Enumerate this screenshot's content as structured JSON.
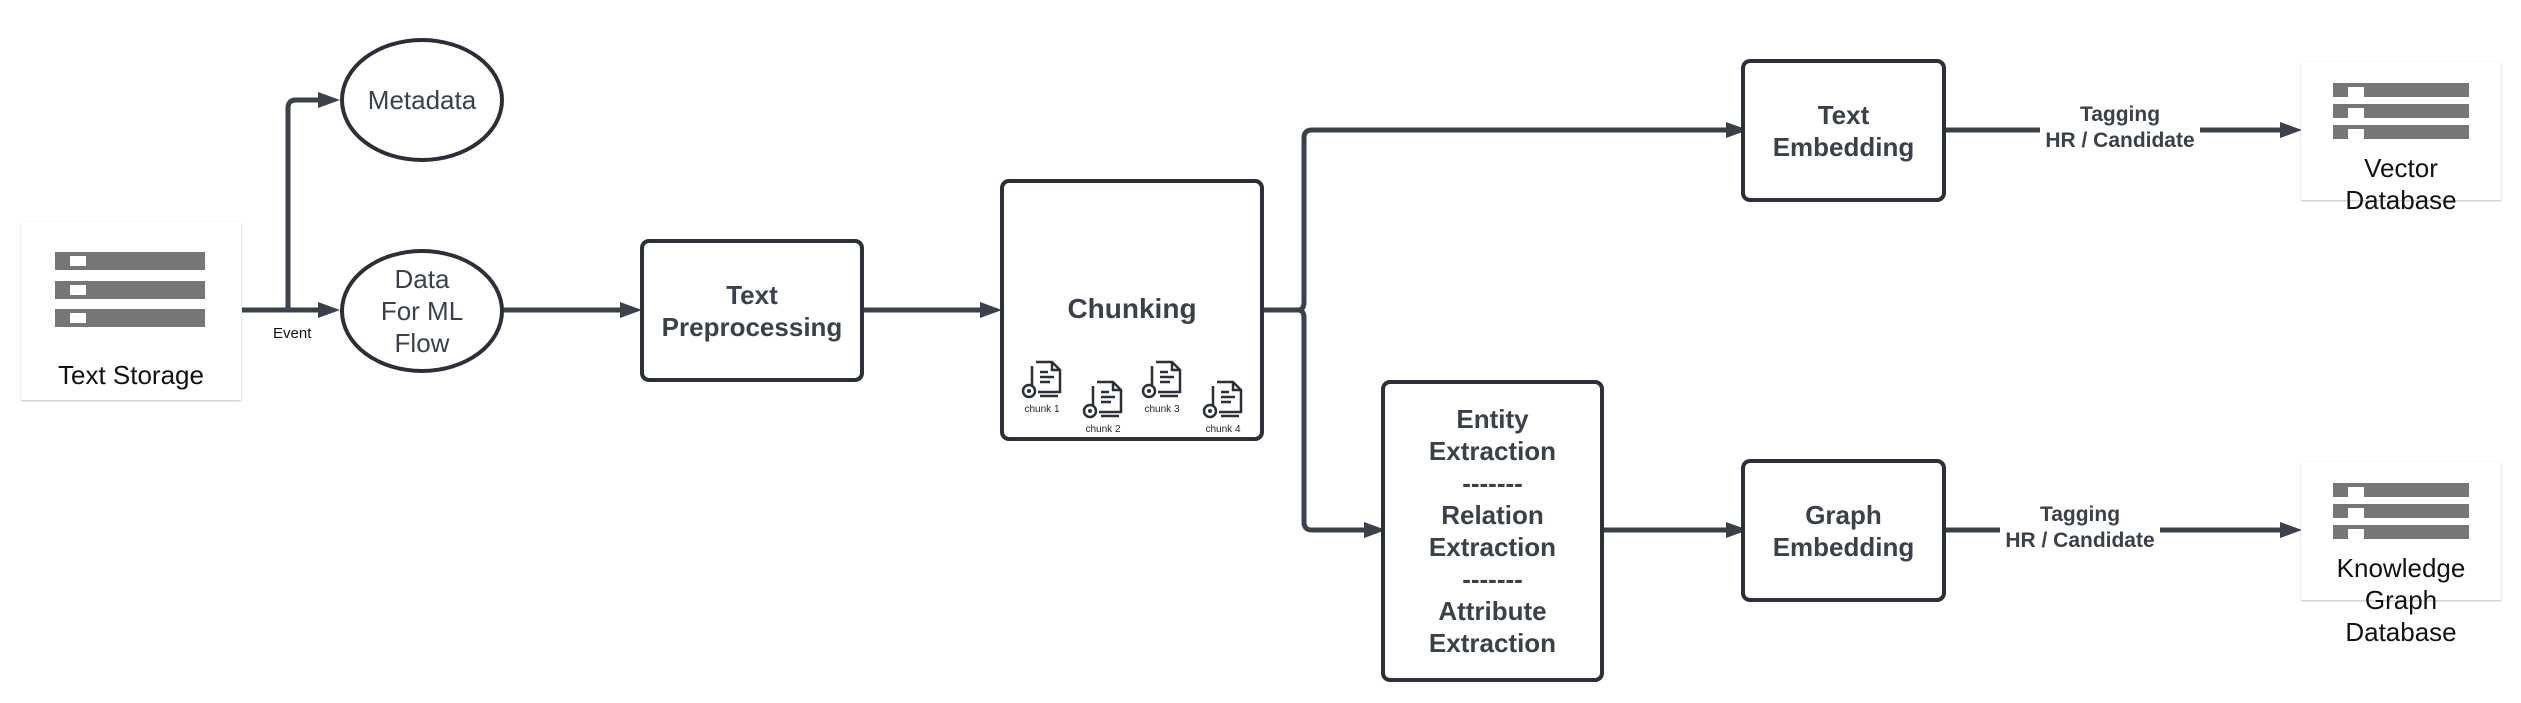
{
  "diagram": {
    "nodes": {
      "text_storage": {
        "label": "Text Storage",
        "icon": "database-icon"
      },
      "metadata": {
        "label": "Metadata"
      },
      "data_for_ml": {
        "lines": [
          "Data",
          "For ML",
          "Flow"
        ]
      },
      "text_preprocessing": {
        "lines": [
          "Text",
          "Preprocessing"
        ]
      },
      "chunking": {
        "label": "Chunking",
        "chunks": [
          {
            "label": "chunk 1",
            "icon": "document-gear-icon"
          },
          {
            "label": "chunk 2",
            "icon": "document-gear-icon"
          },
          {
            "label": "chunk 3",
            "icon": "document-gear-icon"
          },
          {
            "label": "chunk 4",
            "icon": "document-gear-icon"
          }
        ]
      },
      "extraction": {
        "lines": [
          "Entity",
          "Extraction",
          "-------",
          "Relation",
          "Extraction",
          "-------",
          "Attribute",
          "Extraction"
        ]
      },
      "text_embedding": {
        "lines": [
          "Text",
          "Embedding"
        ]
      },
      "graph_embedding": {
        "lines": [
          "Graph",
          "Embedding"
        ]
      },
      "vector_db": {
        "lines": [
          "Vector",
          "Database"
        ],
        "icon": "database-icon"
      },
      "kg_db": {
        "lines": [
          "Knowledge",
          "Graph",
          "Database"
        ],
        "icon": "database-icon"
      }
    },
    "edge_labels": {
      "event": "Event",
      "tagging_top": [
        "Tagging",
        "HR / Candidate"
      ],
      "tagging_bottom": [
        "Tagging",
        "HR / Candidate"
      ]
    },
    "colors": {
      "line": "#3a414a",
      "border": "#2b3038",
      "db_bar": "#767676"
    }
  }
}
